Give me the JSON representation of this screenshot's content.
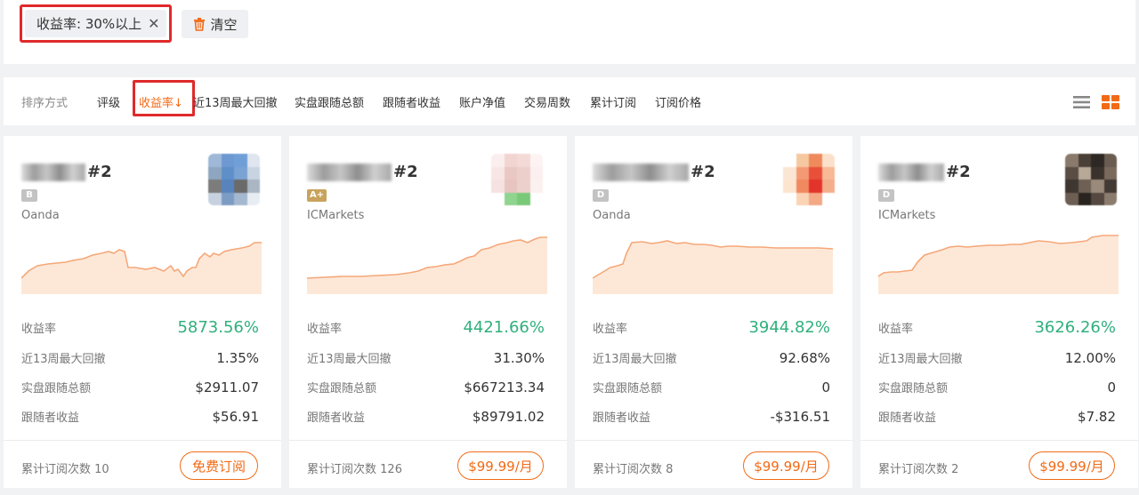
{
  "filter": {
    "chip_label": "收益率:  30%以上",
    "chip_close": "✕",
    "clear_label": "清空"
  },
  "sort": {
    "label": "排序方式",
    "items": [
      "评级",
      "收益率↓",
      "近13周最大回撤",
      "实盘跟随总额",
      "跟随者收益",
      "账户净值",
      "交易周数",
      "累计订阅",
      "订阅价格"
    ]
  },
  "stat_labels": {
    "return": "收益率",
    "drawdown": "近13周最大回撤",
    "follow_total": "实盘跟随总额",
    "follower_profit": "跟随者收益",
    "sub_count": "累计订阅次数"
  },
  "colors": {
    "accent": "#f26a16",
    "green": "#30b07c",
    "highlight": "#e0292b"
  },
  "cards": [
    {
      "rank": "#2",
      "rating": "B",
      "broker": "Oanda",
      "return": "5873.56%",
      "drawdown": "1.35%",
      "follow_total": "$2911.07",
      "follower_profit": "$56.91",
      "sub_count": "10",
      "button": "免费订阅"
    },
    {
      "rank": "#2",
      "rating": "A+",
      "broker": "ICMarkets",
      "return": "4421.66%",
      "drawdown": "31.30%",
      "follow_total": "$667213.34",
      "follower_profit": "$89791.02",
      "sub_count": "126",
      "button": "$99.99/月"
    },
    {
      "rank": "#2",
      "rating": "D",
      "broker": "Oanda",
      "return": "3944.82%",
      "drawdown": "92.68%",
      "follow_total": "0",
      "follower_profit": "-$316.51",
      "sub_count": "8",
      "button": "$99.99/月"
    },
    {
      "rank": "#2",
      "rating": "D",
      "broker": "ICMarkets",
      "return": "3626.26%",
      "drawdown": "12.00%",
      "follow_total": "0",
      "follower_profit": "$7.82",
      "sub_count": "2",
      "button": "$99.99/月"
    }
  ]
}
